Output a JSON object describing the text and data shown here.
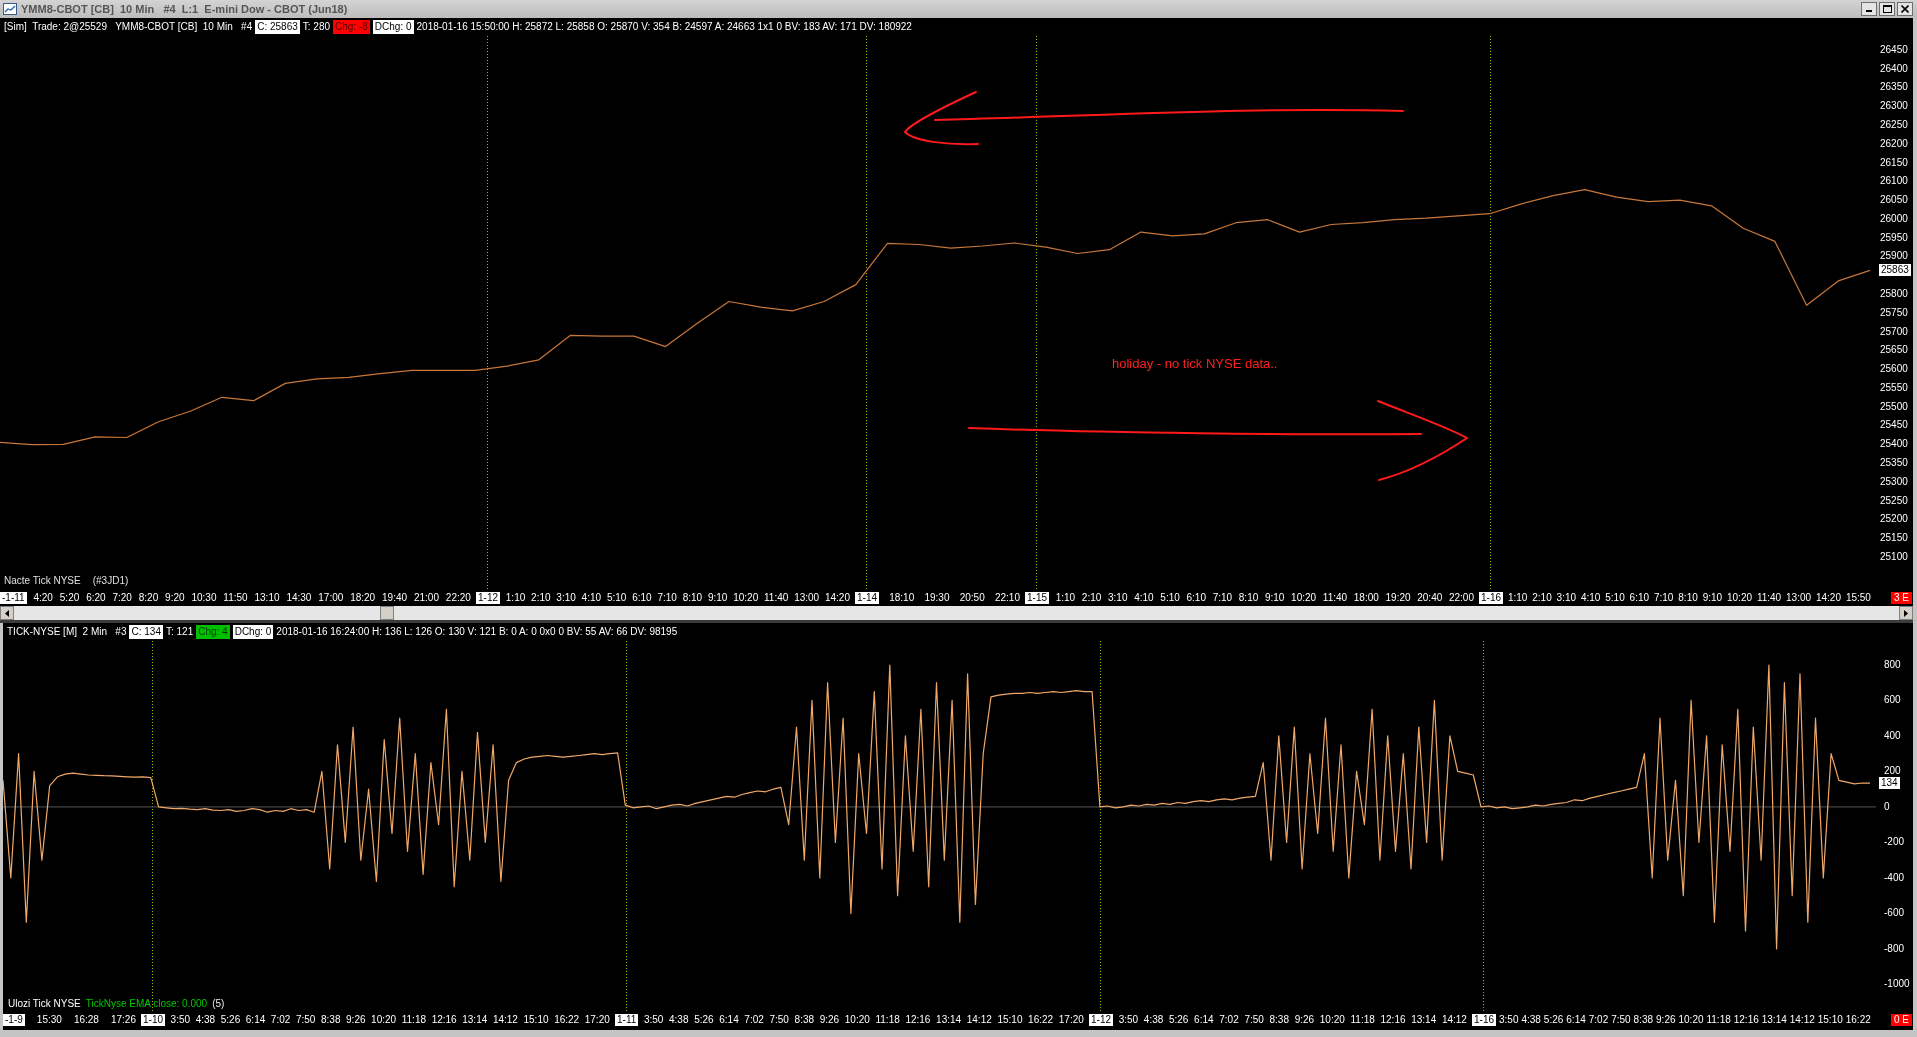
{
  "window": {
    "title": "YMM8-CBOT [CB]  10 Min   #4  L:1  E-mini Dow - CBOT (Jun18)"
  },
  "top_pane": {
    "header": [
      {
        "kind": "text",
        "text": "[Sim]  Trade: 2@25529   YMM8-CBOT [CB]  10 Min   #4"
      },
      {
        "kind": "box",
        "text": "C: 25863"
      },
      {
        "kind": "text",
        "text": "T: 280"
      },
      {
        "kind": "flag",
        "text": "Chg: -8",
        "color": "#ff0000"
      },
      {
        "kind": "box",
        "text": "DChg: 0"
      },
      {
        "kind": "text",
        "text": "2018-01-16 15:50:00 H: 25872 L: 25858 O: 25870 V: 354 B: 24597 A: 24663 1x1 0 BV: 183 AV: 171 DV: 180922"
      }
    ],
    "note": "holiday - no tick NYSE data..",
    "legend": [
      "Nacte Tick NYSE",
      "(#3JD1)"
    ],
    "chart_data": {
      "type": "line",
      "ylim": [
        25012,
        26487
      ],
      "yticks": [
        26450,
        26400,
        26350,
        26300,
        26250,
        26200,
        26150,
        26100,
        26050,
        26000,
        25950,
        25900,
        25800,
        25750,
        25700,
        25650,
        25600,
        25550,
        25500,
        25450,
        25400,
        25350,
        25300,
        25250,
        25200,
        25150,
        25100
      ],
      "series": [
        {
          "color": "#c8773a",
          "values": [
            25405,
            25399,
            25400,
            25420,
            25418,
            25460,
            25488,
            25525,
            25516,
            25562,
            25574,
            25578,
            25588,
            25597,
            25597,
            25597,
            25608,
            25625,
            25690,
            25688,
            25688,
            25660,
            25722,
            25780,
            25765,
            25755,
            25780,
            25825,
            25935,
            25932,
            25922,
            25928,
            25936,
            25925,
            25908,
            25918,
            25965,
            25955,
            25960,
            25990,
            25998,
            25965,
            25985,
            25990,
            25998,
            26002,
            26008,
            26014,
            26040,
            26062,
            26078,
            26058,
            26046,
            26050,
            26035,
            25975,
            25940,
            25770,
            25835,
            25863
          ]
        }
      ]
    },
    "last_price": "25863",
    "sessions": [
      {
        "date": "-1-11",
        "times": [
          "4:20",
          "5:20",
          "6:20",
          "7:20",
          "8:20",
          "9:20",
          "10:30",
          "11:50",
          "13:10",
          "14:30",
          "17:00",
          "18:20",
          "19:40",
          "21:00",
          "22:20"
        ]
      },
      {
        "date": "1-12",
        "times": [
          "1:10",
          "2:10",
          "3:10",
          "4:10",
          "5:10",
          "6:10",
          "7:10",
          "8:10",
          "9:10",
          "10:20",
          "11:40",
          "13:00",
          "14:20"
        ]
      },
      {
        "date": "1-14",
        "times": [
          "18:10",
          "19:30",
          "20:50",
          "22:10"
        ]
      },
      {
        "date": "1-15",
        "times": [
          "1:10",
          "2:10",
          "3:10",
          "4:10",
          "5:10",
          "6:10",
          "7:10",
          "8:10",
          "9:10",
          "10:20",
          "11:40",
          "18:00",
          "19:20",
          "20:40",
          "22:00"
        ]
      },
      {
        "date": "1-16",
        "times": [
          "1:10",
          "2:10",
          "3:10",
          "4:10",
          "5:10",
          "6:10",
          "7:10",
          "8:10",
          "9:10",
          "10:20",
          "11:40",
          "13:00",
          "14:20",
          "15:50"
        ]
      }
    ],
    "corner_badge": "3 E"
  },
  "bottom_pane": {
    "header": [
      {
        "kind": "text",
        "text": "TICK-NYSE [M]  2 Min   #3"
      },
      {
        "kind": "box",
        "text": "C: 134"
      },
      {
        "kind": "text",
        "text": "T: 121"
      },
      {
        "kind": "flag",
        "text": "Chg: 4",
        "color": "#00c000"
      },
      {
        "kind": "box",
        "text": "DChg: 0"
      },
      {
        "kind": "text",
        "text": "2018-01-16 16:24:00 H: 136 L: 126 O: 130 V: 121 B: 0 A: 0 0x0 0 BV: 55 AV: 66 DV: 98195"
      }
    ],
    "legend": [
      {
        "text": "Ulozi Tick NYSE",
        "color": "#ffffff"
      },
      {
        "text": "TickNyse EMA close: 0.000",
        "color": "#00c800"
      },
      {
        "text": "(5)"
      }
    ],
    "chart_data": {
      "type": "line",
      "ylim": [
        -1150,
        935
      ],
      "yticks": [
        800,
        600,
        400,
        200,
        0,
        -200,
        -400,
        -600,
        -800,
        -1000
      ],
      "series": [
        {
          "color": "#f0a868",
          "values": [
            150,
            -400,
            300,
            -650,
            200,
            -300,
            120,
            170,
            185,
            190,
            185,
            180,
            178,
            176,
            175,
            172,
            170,
            168,
            170,
            165,
            0,
            -5,
            -10,
            -8,
            -12,
            -15,
            -10,
            -18,
            -20,
            -15,
            -25,
            -20,
            -10,
            -15,
            -30,
            -20,
            -25,
            -10,
            -20,
            -15,
            -30,
            200,
            -350,
            350,
            -200,
            450,
            -300,
            100,
            -420,
            380,
            -150,
            500,
            -250,
            300,
            -380,
            250,
            -100,
            550,
            -450,
            200,
            -300,
            420,
            -200,
            350,
            -420,
            150,
            250,
            270,
            280,
            285,
            290,
            285,
            280,
            285,
            290,
            295,
            300,
            295,
            300,
            305,
            10,
            -5,
            0,
            5,
            -10,
            0,
            10,
            15,
            5,
            20,
            30,
            40,
            50,
            60,
            55,
            70,
            80,
            90,
            85,
            100,
            110,
            -100,
            450,
            -300,
            600,
            -400,
            700,
            -200,
            500,
            -600,
            300,
            -150,
            650,
            -350,
            800,
            -500,
            400,
            -250,
            550,
            -450,
            700,
            -300,
            600,
            -650,
            750,
            -550,
            300,
            620,
            630,
            635,
            640,
            640,
            645,
            640,
            645,
            650,
            645,
            650,
            655,
            650,
            650,
            0,
            5,
            -5,
            0,
            10,
            5,
            15,
            10,
            20,
            15,
            25,
            20,
            30,
            35,
            30,
            40,
            45,
            40,
            50,
            55,
            60,
            250,
            -300,
            400,
            -200,
            450,
            -350,
            300,
            -150,
            500,
            -250,
            350,
            -400,
            200,
            -100,
            550,
            -300,
            400,
            -250,
            300,
            -350,
            450,
            -200,
            600,
            -300,
            400,
            200,
            190,
            180,
            0,
            5,
            -5,
            0,
            -10,
            -5,
            0,
            10,
            5,
            15,
            20,
            25,
            40,
            35,
            50,
            60,
            70,
            80,
            90,
            100,
            110,
            300,
            -400,
            500,
            -300,
            150,
            -500,
            600,
            -200,
            400,
            -650,
            350,
            -250,
            550,
            -700,
            450,
            -300,
            800,
            -800,
            700,
            -500,
            750,
            -650,
            500,
            -400,
            300,
            150,
            140,
            130,
            135,
            134
          ]
        }
      ]
    },
    "last_value": "134",
    "sessions": [
      {
        "date": "-1-9",
        "times": [
          "15:30",
          "16:28",
          "17:26"
        ]
      },
      {
        "date": "1-10",
        "times": [
          "3:50",
          "4:38",
          "5:26",
          "6:14",
          "7:02",
          "7:50",
          "8:38",
          "9:26",
          "10:20",
          "11:18",
          "12:16",
          "13:14",
          "14:12",
          "15:10",
          "16:22",
          "17:20"
        ]
      },
      {
        "date": "1-11",
        "times": [
          "3:50",
          "4:38",
          "5:26",
          "6:14",
          "7:02",
          "7:50",
          "8:38",
          "9:26",
          "10:20",
          "11:18",
          "12:16",
          "13:14",
          "14:12",
          "15:10",
          "16:22",
          "17:20"
        ]
      },
      {
        "date": "1-12",
        "times": [
          "3:50",
          "4:38",
          "5:26",
          "6:14",
          "7:02",
          "7:50",
          "8:38",
          "9:26",
          "10:20",
          "11:18",
          "12:16",
          "13:14",
          "14:12"
        ]
      },
      {
        "date": "1-16",
        "times": [
          "3:50",
          "4:38",
          "5:26",
          "6:14",
          "7:02",
          "7:50",
          "8:38",
          "9:26",
          "10:20",
          "11:18",
          "12:16",
          "13:14",
          "14:12",
          "15:10",
          "16:22"
        ]
      }
    ],
    "corner_badge": "0 E"
  }
}
